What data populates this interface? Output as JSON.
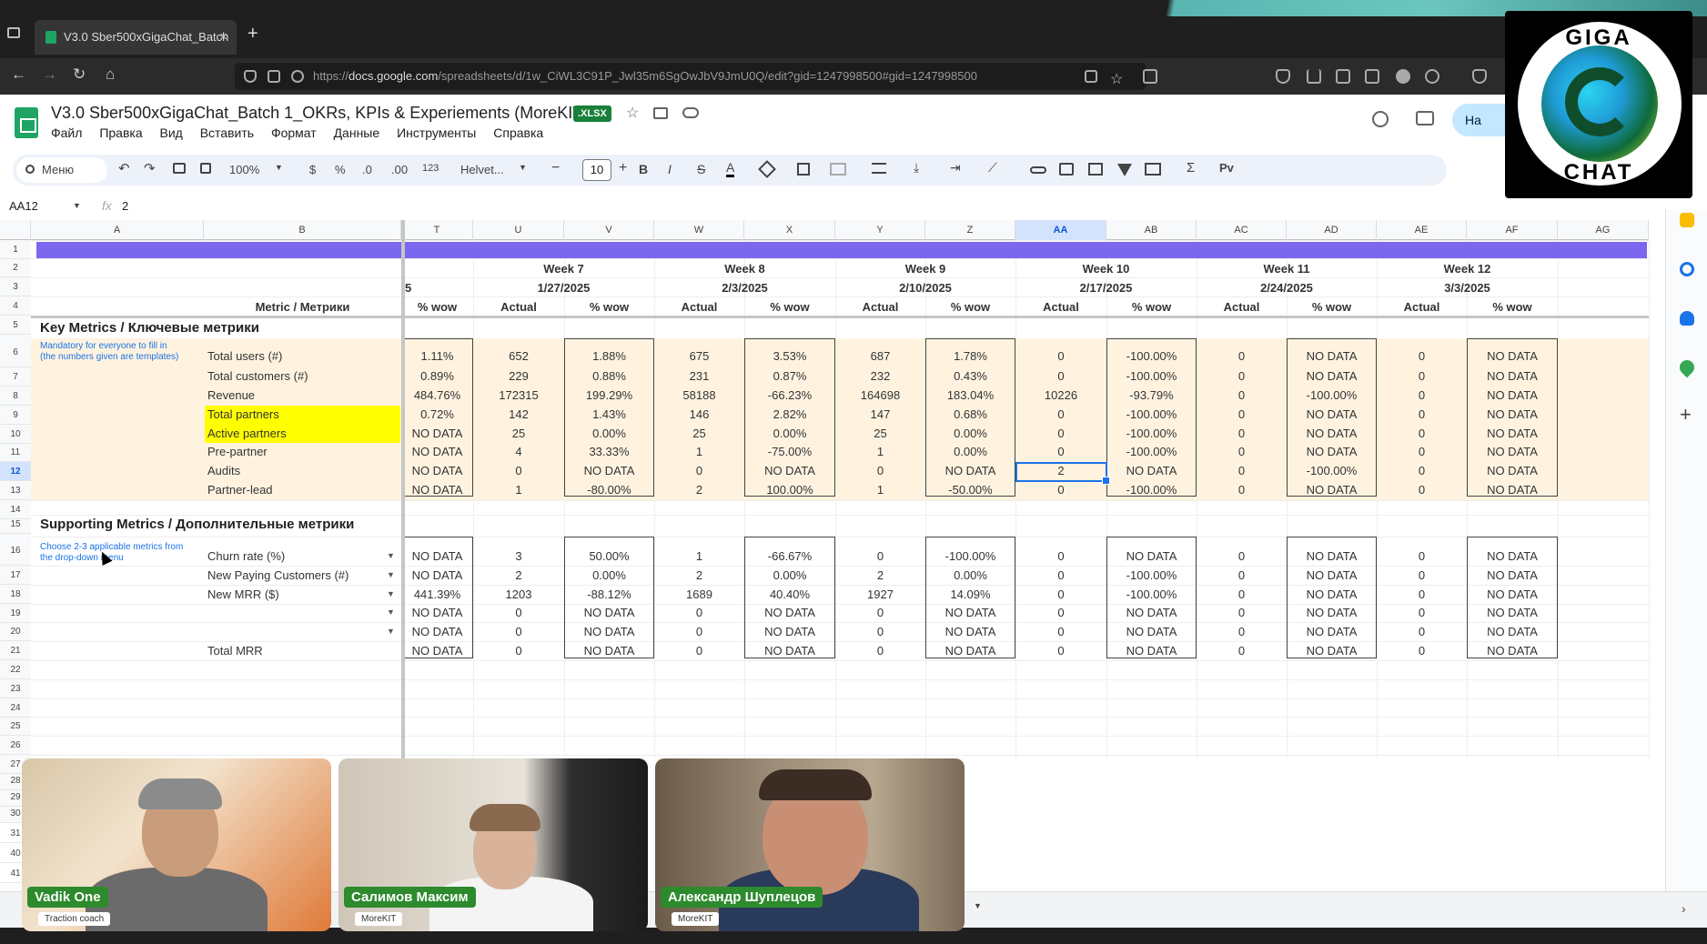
{
  "browser": {
    "tab_title": "V3.0 Sber500xGigaChat_Batch",
    "tab_close": "×",
    "new_tab": "+",
    "url_prefix": "https://",
    "url_host": "docs.google.com",
    "url_path": "/spreadsheets/d/1w_CiWL3C91P_Jwl35m6SgOwJbV9JmU0Q/edit?gid=1247998500#gid=1247998500",
    "nav": {
      "back": "←",
      "forward": "→",
      "reload": "↻",
      "home": "⌂"
    }
  },
  "sheet": {
    "title": "V3.0 Sber500xGigaChat_Batch 1_OKRs, KPIs & Experiements (MoreKIT)",
    "badge": ".XLSX",
    "menu": [
      "Файл",
      "Правка",
      "Вид",
      "Вставить",
      "Формат",
      "Данные",
      "Инструменты",
      "Справка"
    ],
    "share_label": "На",
    "toolbar": {
      "search": "Меню",
      "zoom": "100%",
      "currency": "$",
      "percent": "%",
      "dec_less": ".0",
      "dec_more": ".00",
      "number_format": "123",
      "font": "Helvet...",
      "font_size": "10",
      "minus": "−",
      "plus": "+",
      "bold": "B",
      "italic": "I",
      "strike": "S",
      "text_color": "A",
      "sum": "Σ",
      "lang": "Рv"
    },
    "name_box": "AA12",
    "formula_value": "2",
    "column_letters": [
      "A",
      "B",
      "T",
      "U",
      "V",
      "W",
      "X",
      "Y",
      "Z",
      "AA",
      "AB",
      "AC",
      "AD",
      "AE",
      "AF",
      "AG"
    ],
    "selected_column": "AA",
    "row_numbers": [
      "1",
      "2",
      "3",
      "4",
      "5",
      "6",
      "7",
      "8",
      "9",
      "10",
      "11",
      "12",
      "13",
      "14",
      "15",
      "16",
      "17",
      "18",
      "19",
      "20",
      "21",
      "22",
      "23",
      "24",
      "25",
      "26",
      "27",
      "28",
      "29",
      "30",
      "31",
      "40",
      "41"
    ],
    "selected_row": "12",
    "header": {
      "metric_label": "Metric / Метрики",
      "partial_col": "5",
      "partial_wow": "% wow",
      "weeks": [
        {
          "week": "Week 7",
          "date": "1/27/2025",
          "actual": "Actual",
          "wow": "% wow"
        },
        {
          "week": "Week 8",
          "date": "2/3/2025",
          "actual": "Actual",
          "wow": "% wow"
        },
        {
          "week": "Week 9",
          "date": "2/10/2025",
          "actual": "Actual",
          "wow": "% wow"
        },
        {
          "week": "Week 10",
          "date": "2/17/2025",
          "actual": "Actual",
          "wow": "% wow"
        },
        {
          "week": "Week 11",
          "date": "2/24/2025",
          "actual": "Actual",
          "wow": "% wow"
        },
        {
          "week": "Week 12",
          "date": "3/3/2025",
          "actual": "Actual",
          "wow": "% wow"
        }
      ]
    },
    "key_metrics": {
      "title": "Key Metrics / Ключевые метрики",
      "note1": "Mandatory for everyone to fill in",
      "note2": "(the numbers given are templates)",
      "rows": [
        {
          "label": "Total users (#)",
          "t": "1.11%",
          "vals": [
            "652",
            "1.88%",
            "675",
            "3.53%",
            "687",
            "1.78%",
            "0",
            "-100.00%",
            "0",
            "NO DATA",
            "0",
            "NO DATA"
          ]
        },
        {
          "label": "Total customers (#)",
          "t": "0.89%",
          "vals": [
            "229",
            "0.88%",
            "231",
            "0.87%",
            "232",
            "0.43%",
            "0",
            "-100.00%",
            "0",
            "NO DATA",
            "0",
            "NO DATA"
          ]
        },
        {
          "label": "Revenue",
          "t": "484.76%",
          "vals": [
            "172315",
            "199.29%",
            "58188",
            "-66.23%",
            "164698",
            "183.04%",
            "10226",
            "-93.79%",
            "0",
            "-100.00%",
            "0",
            "NO DATA"
          ]
        },
        {
          "label": "Total partners",
          "t": "0.72%",
          "vals": [
            "142",
            "1.43%",
            "146",
            "2.82%",
            "147",
            "0.68%",
            "0",
            "-100.00%",
            "0",
            "NO DATA",
            "0",
            "NO DATA"
          ]
        },
        {
          "label": "Active partners",
          "t": "NO DATA",
          "vals": [
            "25",
            "0.00%",
            "25",
            "0.00%",
            "25",
            "0.00%",
            "0",
            "-100.00%",
            "0",
            "NO DATA",
            "0",
            "NO DATA"
          ]
        },
        {
          "label": "Pre-partner",
          "t": "NO DATA",
          "vals": [
            "4",
            "33.33%",
            "1",
            "-75.00%",
            "1",
            "0.00%",
            "0",
            "-100.00%",
            "0",
            "NO DATA",
            "0",
            "NO DATA"
          ]
        },
        {
          "label": "Audits",
          "t": "NO DATA",
          "vals": [
            "0",
            "NO DATA",
            "0",
            "NO DATA",
            "0",
            "NO DATA",
            "2",
            "NO DATA",
            "0",
            "-100.00%",
            "0",
            "NO DATA"
          ]
        },
        {
          "label": "Partner-lead",
          "t": "NO DATA",
          "vals": [
            "1",
            "-80.00%",
            "2",
            "100.00%",
            "1",
            "-50.00%",
            "0",
            "-100.00%",
            "0",
            "NO DATA",
            "0",
            "NO DATA"
          ]
        }
      ]
    },
    "supporting_metrics": {
      "title": "Supporting Metrics / Дополнительные метрики",
      "note1": "Choose 2-3 applicable metrics from",
      "note2": "the drop-down menu",
      "rows": [
        {
          "label": "Churn rate (%)",
          "t": "NO DATA",
          "vals": [
            "3",
            "50.00%",
            "1",
            "-66.67%",
            "0",
            "-100.00%",
            "0",
            "NO DATA",
            "0",
            "NO DATA",
            "0",
            "NO DATA"
          ]
        },
        {
          "label": "New Paying Customers (#)",
          "t": "NO DATA",
          "vals": [
            "2",
            "0.00%",
            "2",
            "0.00%",
            "2",
            "0.00%",
            "0",
            "-100.00%",
            "0",
            "NO DATA",
            "0",
            "NO DATA"
          ]
        },
        {
          "label": "New MRR ($)",
          "t": "441.39%",
          "vals": [
            "1203",
            "-88.12%",
            "1689",
            "40.40%",
            "1927",
            "14.09%",
            "0",
            "-100.00%",
            "0",
            "NO DATA",
            "0",
            "NO DATA"
          ]
        },
        {
          "label": "",
          "t": "NO DATA",
          "vals": [
            "0",
            "NO DATA",
            "0",
            "NO DATA",
            "0",
            "NO DATA",
            "0",
            "NO DATA",
            "0",
            "NO DATA",
            "0",
            "NO DATA"
          ]
        },
        {
          "label": "",
          "t": "NO DATA",
          "vals": [
            "0",
            "NO DATA",
            "0",
            "NO DATA",
            "0",
            "NO DATA",
            "0",
            "NO DATA",
            "0",
            "NO DATA",
            "0",
            "NO DATA"
          ]
        },
        {
          "label": "Total MRR",
          "t": "NO DATA",
          "vals": [
            "0",
            "NO DATA",
            "0",
            "NO DATA",
            "0",
            "NO DATA",
            "0",
            "NO DATA",
            "0",
            "NO DATA",
            "0",
            "NO DATA"
          ]
        }
      ]
    },
    "colors": {
      "purple_band": "#7b68ee",
      "highlight": "#ffff00",
      "row_band": "#fff3e0",
      "selection": "#1a73e8"
    }
  },
  "video": [
    {
      "name": "Vadik One",
      "role": "Traction coach"
    },
    {
      "name": "Салимов Максим",
      "role": "MoreKIT"
    },
    {
      "name": "Александр Шуплецов",
      "role": "MoreKIT"
    }
  ],
  "logo": {
    "top": "GIGA",
    "bottom": "CHAT"
  }
}
